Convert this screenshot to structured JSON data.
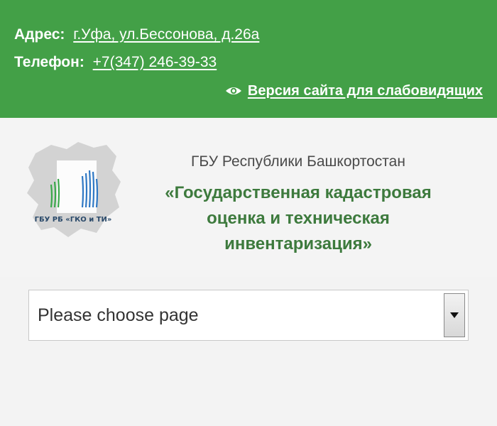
{
  "topbar": {
    "address_label": "Адрес:",
    "address_value": "г.Уфа, ул.Бессонова, д.26а",
    "phone_label": "Телефон:",
    "phone_value": "+7(347) 246-39-33",
    "accessibility_link": "Версия сайта для слабовидящих"
  },
  "header": {
    "logo_caption": "ГБУ РБ «ГКО и ТИ»",
    "org_subtitle": "ГБУ Республики Башкортостан",
    "org_title_line1": "«Государственная кадастровая",
    "org_title_line2": "оценка и техническая",
    "org_title_line3": "инвентаризация»"
  },
  "page_select": {
    "value": "Please choose page"
  },
  "colors": {
    "topbar_bg": "#43a047",
    "title_green": "#3d7a3d"
  },
  "icons": {
    "accessibility": "eye-icon",
    "select": "triangle-down-icon"
  }
}
